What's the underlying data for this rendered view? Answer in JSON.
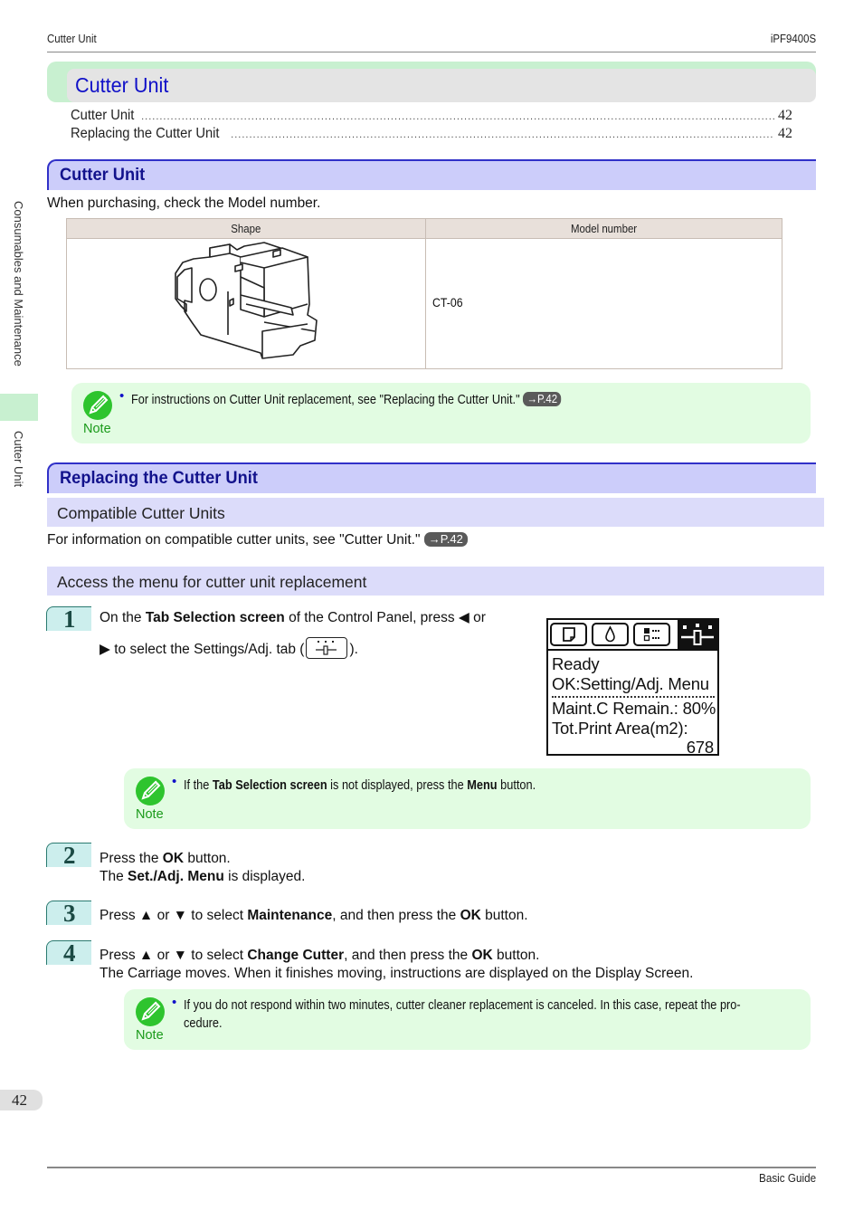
{
  "header": {
    "section": "Cutter Unit",
    "model": "iPF9400S"
  },
  "chapter": {
    "title": "Cutter Unit",
    "toc": [
      {
        "label": "Cutter Unit",
        "page": "42"
      },
      {
        "label": "Replacing the Cutter Unit",
        "page": "42"
      }
    ]
  },
  "side_tabs": {
    "chapter": "Consumables and Maintenance",
    "current": "Cutter Unit"
  },
  "section1": {
    "title": "Cutter Unit",
    "intro": "When purchasing, check the Model number.",
    "table": {
      "headers": [
        "Shape",
        "Model number"
      ],
      "rows": [
        {
          "shape": "cutter-unit-illustration",
          "model": "CT-06"
        }
      ]
    },
    "note": {
      "label": "Note",
      "text": "For instructions on Cutter Unit replacement, see \"Replacing the Cutter Unit.\"",
      "ref": "→P.42"
    }
  },
  "section2": {
    "title": "Replacing the Cutter Unit",
    "sub1": {
      "title": "Compatible Cutter Units",
      "text": "For information on compatible cutter units, see \"Cutter Unit.\"",
      "ref": "→P.42"
    },
    "sub2": {
      "title": "Access the menu for cutter unit replacement"
    },
    "steps": [
      {
        "num": "1",
        "line1_pre": "On the ",
        "line1_bold": "Tab Selection screen",
        "line1_post": " of the Control Panel, press ◀ or",
        "line2_pre": "▶ to select the Settings/Adj. tab (",
        "line2_post": ")."
      },
      {
        "num": "2",
        "line1_pre": "Press the ",
        "line1_bold": "OK",
        "line1_post": " button.",
        "line2_pre": "The ",
        "line2_bold": "Set./Adj. Menu",
        "line2_post": " is displayed."
      },
      {
        "num": "3",
        "line1_pre": "Press ▲ or ▼ to select ",
        "line1_bold": "Maintenance",
        "line1_mid": ", and then press the ",
        "line1_bold2": "OK",
        "line1_post": " button."
      },
      {
        "num": "4",
        "line1_pre": "Press ▲ or ▼ to select ",
        "line1_bold": "Change Cutter",
        "line1_mid": ", and then press the ",
        "line1_bold2": "OK",
        "line1_post": " button.",
        "line2": "The Carriage moves. When it finishes moving, instructions are displayed on the Display Screen."
      }
    ],
    "lcd": {
      "tabs": [
        "paper-tab-icon",
        "ink-tab-icon",
        "job-tab-icon",
        "settings-adj-tab-icon"
      ],
      "active_tab": 3,
      "line1": "Ready",
      "line2": "OK:Setting/Adj. Menu",
      "line3": "Maint.C Remain.: 80%",
      "line4": "Tot.Print Area(m2):",
      "line5": "678"
    },
    "note2": {
      "label": "Note",
      "pre": "If the ",
      "bold1": "Tab Selection screen",
      "mid": " is not displayed, press the ",
      "bold2": "Menu",
      "post": " button."
    },
    "note3": {
      "label": "Note",
      "line1": "If you do not respond within two minutes, cutter cleaner replacement is canceled. In this case, repeat the pro-",
      "line2": "cedure."
    }
  },
  "footer": {
    "page": "42",
    "guide": "Basic Guide"
  }
}
